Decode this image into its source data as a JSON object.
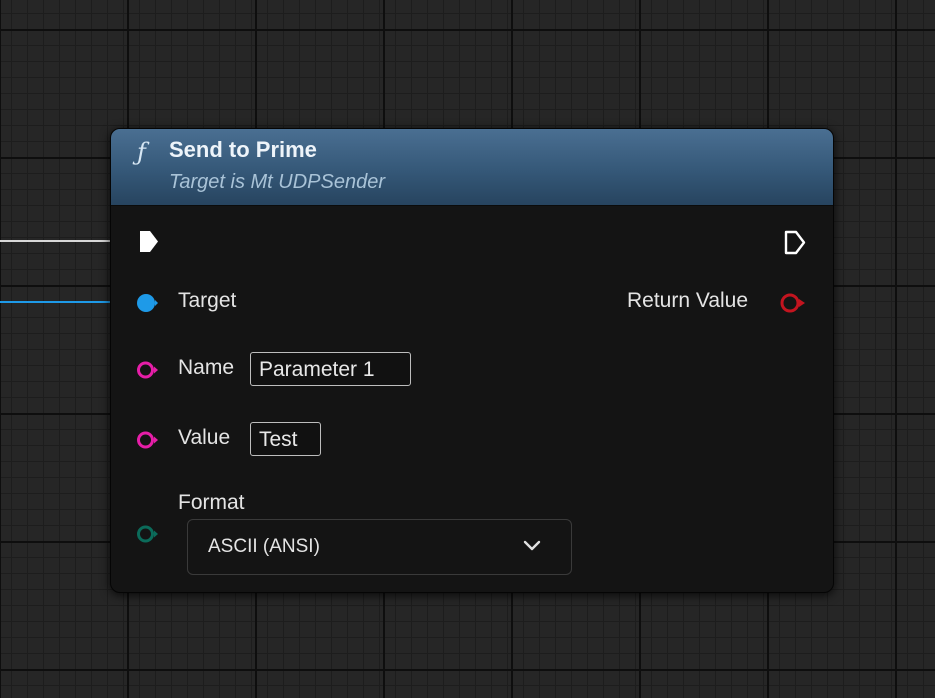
{
  "node": {
    "icon": "function-icon",
    "title": "Send to Prime",
    "subtitle": "Target is Mt UDPSender"
  },
  "pins": {
    "target_label": "Target",
    "return_label": "Return Value",
    "name_label": "Name",
    "name_value": "Parameter 1",
    "value_label": "Value",
    "value_value": "Test",
    "format_label": "Format",
    "format_value": "ASCII (ANSI)"
  },
  "colors": {
    "header": "#355878",
    "object_pin": "#1e9ae8",
    "string_pin": "#e61ea8",
    "return_pin": "#c3141f",
    "enum_pin": "#0b6b5a",
    "exec_pin": "#ffffff"
  }
}
